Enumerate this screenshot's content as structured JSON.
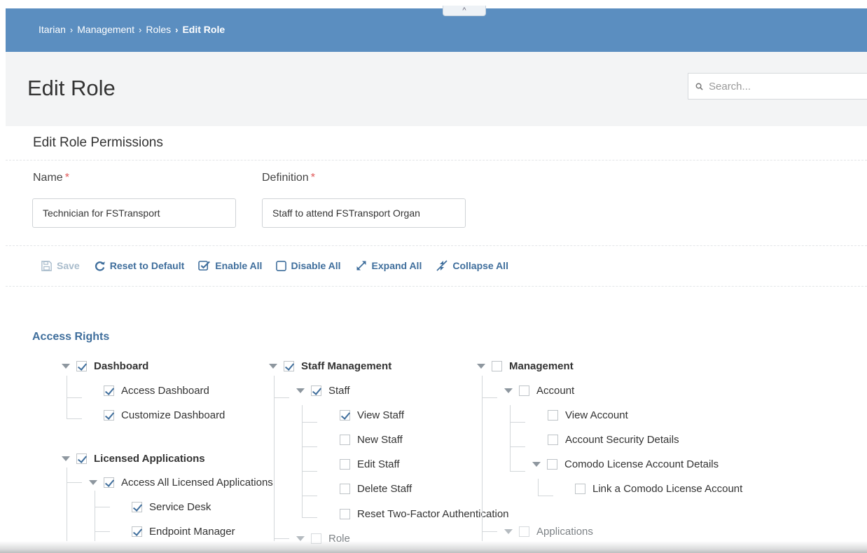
{
  "breadcrumb": {
    "items": [
      "Itarian",
      "Management",
      "Roles"
    ],
    "current": "Edit Role",
    "separator": "›"
  },
  "collapse_tab": "^",
  "page": {
    "title": "Edit Role",
    "search_placeholder": "Search..."
  },
  "section_title": "Edit Role Permissions",
  "form": {
    "name_label": "Name",
    "name_value": "Technician for FSTransport",
    "definition_label": "Definition",
    "definition_value": "Staff to attend FSTransport Organ",
    "required_mark": "*"
  },
  "toolbar": {
    "save": "Save",
    "reset": "Reset to Default",
    "enable_all": "Enable All",
    "disable_all": "Disable All",
    "expand_all": "Expand All",
    "collapse_all": "Collapse All"
  },
  "access_rights": {
    "title": "Access Rights",
    "col1": {
      "dashboard": "Dashboard",
      "access_dashboard": "Access Dashboard",
      "customize_dashboard": "Customize Dashboard",
      "licensed_applications": "Licensed Applications",
      "access_all_licensed": "Access All Licensed Applications",
      "service_desk": "Service Desk",
      "endpoint_manager": "Endpoint Manager"
    },
    "col2": {
      "staff_management": "Staff Management",
      "staff": "Staff",
      "view_staff": "View Staff",
      "new_staff": "New Staff",
      "edit_staff": "Edit Staff",
      "delete_staff": "Delete Staff",
      "reset_2fa": "Reset Two-Factor Authentication",
      "role": "Role"
    },
    "col3": {
      "management": "Management",
      "account": "Account",
      "view_account": "View Account",
      "account_security": "Account Security Details",
      "comodo_license": "Comodo License Account Details",
      "link_comodo": "Link a Comodo License Account",
      "applications": "Applications"
    }
  },
  "colors": {
    "topbar": "#5b8ec0",
    "accent": "#3f6e9c",
    "required": "#e05555"
  }
}
